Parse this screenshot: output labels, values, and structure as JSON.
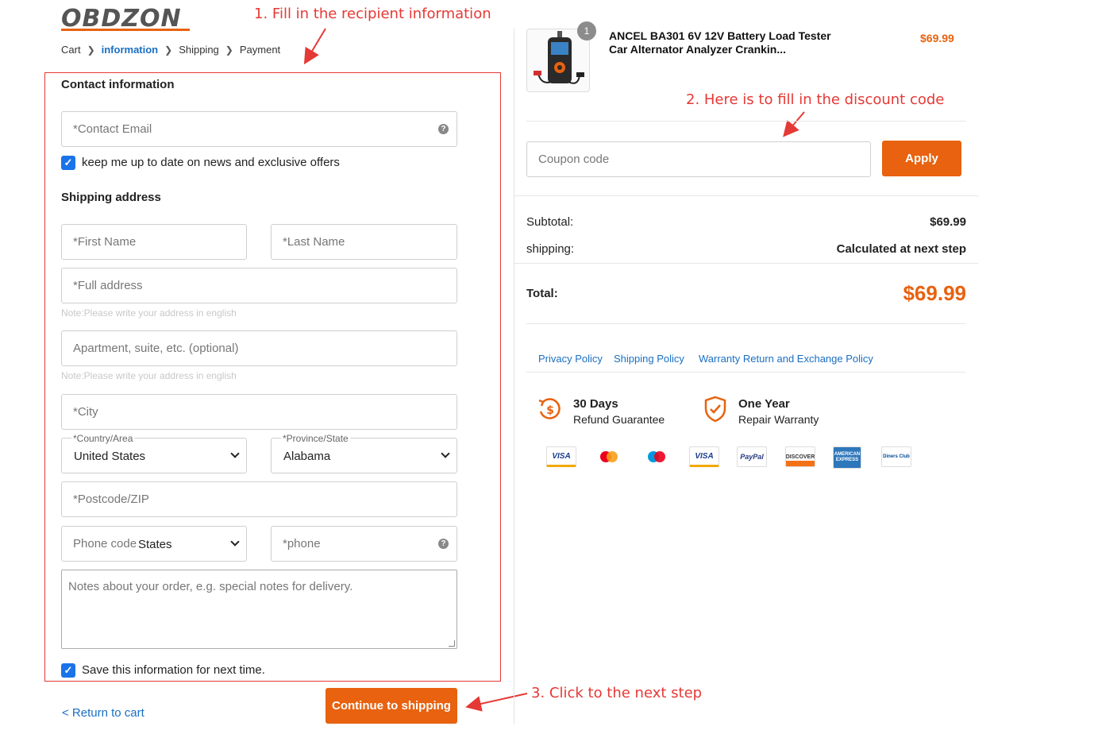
{
  "brand": {
    "logo_text": "OBDZON"
  },
  "breadcrumb": [
    {
      "label": "Cart"
    },
    {
      "label": "information"
    },
    {
      "label": "Shipping"
    },
    {
      "label": "Payment"
    }
  ],
  "annotations": {
    "step1": "1. Fill in the recipient information",
    "step2": "2. Here is to fill in the discount code",
    "step3": "3. Click to the next step"
  },
  "contact": {
    "title": "Contact information",
    "email_placeholder": "*Contact Email",
    "newsletter_label": "keep me up to date on news and exclusive offers",
    "newsletter_checked": true
  },
  "shipping": {
    "title": "Shipping address",
    "first_name_placeholder": "*First Name",
    "last_name_placeholder": "*Last Name",
    "address_placeholder": "*Full address",
    "address_note": "Note:Please write your address in english",
    "apartment_placeholder": "Apartment, suite, etc. (optional)",
    "apartment_note": "Note:Please write your address in english",
    "city_placeholder": "*City",
    "country_label": "*Country/Area",
    "country_value": "United States",
    "province_label": "*Province/State",
    "province_value": "Alabama",
    "postcode_placeholder": "*Postcode/ZIP",
    "phone_code_placeholder": "Phone code",
    "phone_code_value": "States",
    "phone_placeholder": "*phone",
    "order_notes_placeholder": "Notes about your order, e.g. special notes for delivery.",
    "save_info_label": "Save this information for next time.",
    "save_info_checked": true
  },
  "actions": {
    "return_label": "< Return to cart",
    "continue_label": "Continue to shipping"
  },
  "order": {
    "quantity": "1",
    "product_title": "ANCEL BA301 6V 12V Battery Load Tester Car Alternator Analyzer Crankin...",
    "product_price": "$69.99",
    "coupon_placeholder": "Coupon code",
    "apply_label": "Apply",
    "subtotal_label": "Subtotal:",
    "subtotal_value": "$69.99",
    "shipping_label": "shipping:",
    "shipping_value": "Calculated at next step",
    "total_label": "Total:",
    "total_value": "$69.99"
  },
  "policies": [
    {
      "label": "Privacy Policy"
    },
    {
      "label": "Shipping Policy"
    },
    {
      "label": "Warranty Return and Exchange Policy"
    }
  ],
  "guarantees": [
    {
      "title": "30 Days",
      "subtitle": "Refund Guarantee",
      "icon": "refund-dollar-icon"
    },
    {
      "title": "One Year",
      "subtitle": "Repair Warranty",
      "icon": "shield-check-icon"
    }
  ],
  "payment_methods": [
    "VISA",
    "Mastercard",
    "Maestro",
    "VISA",
    "PayPal",
    "DISCOVER",
    "AMERICAN EXPRESS",
    "Diners Club"
  ],
  "colors": {
    "accent": "#e8620f",
    "link": "#1a6fc2",
    "annotation": "#e53935",
    "checkbox": "#1a73e8"
  }
}
